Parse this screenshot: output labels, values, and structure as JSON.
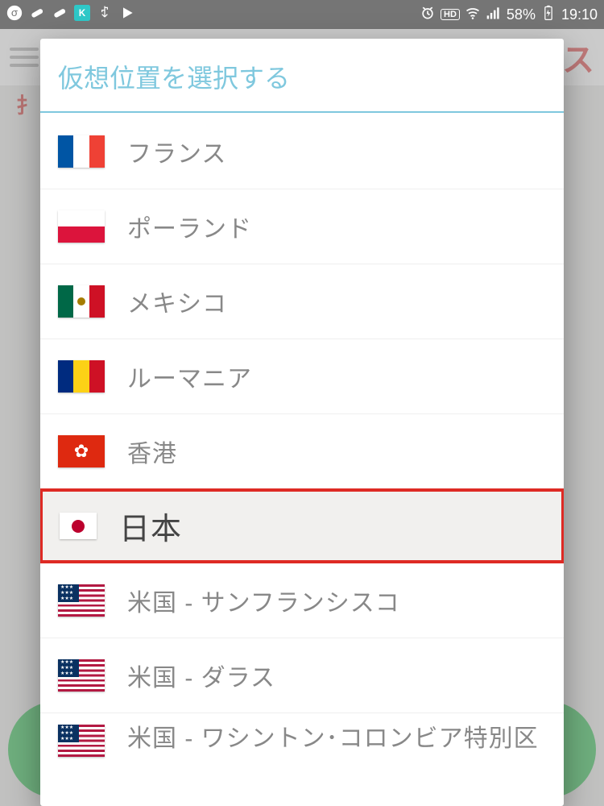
{
  "statusbar": {
    "battery_percent": "58%",
    "time": "19:10"
  },
  "dialog": {
    "title": "仮想位置を選択する"
  },
  "locations": [
    {
      "flag": "fr",
      "label": "フランス",
      "selected": false
    },
    {
      "flag": "pl",
      "label": "ポーランド",
      "selected": false
    },
    {
      "flag": "mx",
      "label": "メキシコ",
      "selected": false
    },
    {
      "flag": "ro",
      "label": "ルーマニア",
      "selected": false
    },
    {
      "flag": "hk",
      "label": "香港",
      "selected": false
    },
    {
      "flag": "jp",
      "label": "日本",
      "selected": true
    },
    {
      "flag": "us",
      "label": "米国 - サンフランシスコ",
      "selected": false
    },
    {
      "flag": "us",
      "label": "米国 - ダラス",
      "selected": false
    },
    {
      "flag": "us",
      "label": "米国 - ワシントン･コロンビア特別区",
      "selected": false
    }
  ]
}
